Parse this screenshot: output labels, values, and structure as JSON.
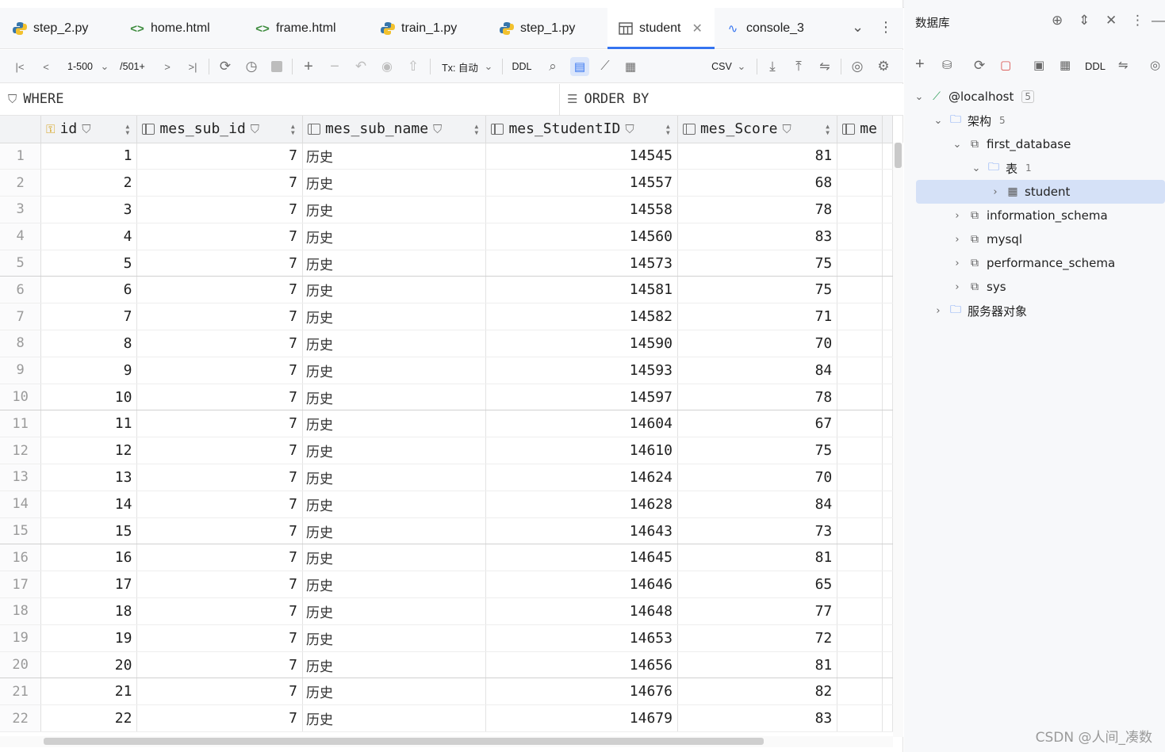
{
  "tabs": [
    {
      "label": "step_2.py",
      "icon": "python-icon"
    },
    {
      "label": "home.html",
      "icon": "html-icon"
    },
    {
      "label": "frame.html",
      "icon": "html-icon"
    },
    {
      "label": "train_1.py",
      "icon": "python-icon"
    },
    {
      "label": "step_1.py",
      "icon": "python-icon"
    },
    {
      "label": "student",
      "icon": "table-icon",
      "active": true
    },
    {
      "label": "console_3",
      "icon": "console-icon"
    }
  ],
  "toolbar": {
    "range": "1-500",
    "total": "/501+",
    "tx_label": "Tx: 自动",
    "ddl_label": "DDL",
    "export_format": "CSV"
  },
  "filter": {
    "where_label": "WHERE",
    "orderby_label": "ORDER BY"
  },
  "grid": {
    "columns": [
      "id",
      "mes_sub_id",
      "mes_sub_name",
      "mes_StudentID",
      "mes_Score",
      "me"
    ],
    "rows": [
      [
        "1",
        "1",
        "7",
        "历史",
        "14545",
        "81"
      ],
      [
        "2",
        "2",
        "7",
        "历史",
        "14557",
        "68"
      ],
      [
        "3",
        "3",
        "7",
        "历史",
        "14558",
        "78"
      ],
      [
        "4",
        "4",
        "7",
        "历史",
        "14560",
        "83"
      ],
      [
        "5",
        "5",
        "7",
        "历史",
        "14573",
        "75"
      ],
      [
        "6",
        "6",
        "7",
        "历史",
        "14581",
        "75"
      ],
      [
        "7",
        "7",
        "7",
        "历史",
        "14582",
        "71"
      ],
      [
        "8",
        "8",
        "7",
        "历史",
        "14590",
        "70"
      ],
      [
        "9",
        "9",
        "7",
        "历史",
        "14593",
        "84"
      ],
      [
        "10",
        "10",
        "7",
        "历史",
        "14597",
        "78"
      ],
      [
        "11",
        "11",
        "7",
        "历史",
        "14604",
        "67"
      ],
      [
        "12",
        "12",
        "7",
        "历史",
        "14610",
        "75"
      ],
      [
        "13",
        "13",
        "7",
        "历史",
        "14624",
        "70"
      ],
      [
        "14",
        "14",
        "7",
        "历史",
        "14628",
        "84"
      ],
      [
        "15",
        "15",
        "7",
        "历史",
        "14643",
        "73"
      ],
      [
        "16",
        "16",
        "7",
        "历史",
        "14645",
        "81"
      ],
      [
        "17",
        "17",
        "7",
        "历史",
        "14646",
        "65"
      ],
      [
        "18",
        "18",
        "7",
        "历史",
        "14648",
        "77"
      ],
      [
        "19",
        "19",
        "7",
        "历史",
        "14653",
        "72"
      ],
      [
        "20",
        "20",
        "7",
        "历史",
        "14656",
        "81"
      ],
      [
        "21",
        "21",
        "7",
        "历史",
        "14676",
        "82"
      ],
      [
        "22",
        "22",
        "7",
        "历史",
        "14679",
        "83"
      ]
    ]
  },
  "db_panel": {
    "title": "数据库",
    "ddl_label": "DDL",
    "tree": [
      {
        "label": "@localhost",
        "badge": "5",
        "icon": "datasource-icon"
      },
      {
        "label": "架构",
        "badge": "5",
        "icon": "folder-icon"
      },
      {
        "label": "first_database",
        "icon": "schema-icon"
      },
      {
        "label": "表",
        "badge": "1",
        "icon": "folder-icon"
      },
      {
        "label": "student",
        "icon": "table-icon",
        "selected": true
      },
      {
        "label": "information_schema",
        "icon": "schema-icon"
      },
      {
        "label": "mysql",
        "icon": "schema-icon"
      },
      {
        "label": "performance_schema",
        "icon": "schema-icon"
      },
      {
        "label": "sys",
        "icon": "schema-icon"
      },
      {
        "label": "服务器对象",
        "icon": "server-objects-icon"
      }
    ]
  },
  "watermark": "CSDN @人间_凑数",
  "colors": {
    "accent": "#3574f0",
    "selection": "#d5e1f7"
  }
}
